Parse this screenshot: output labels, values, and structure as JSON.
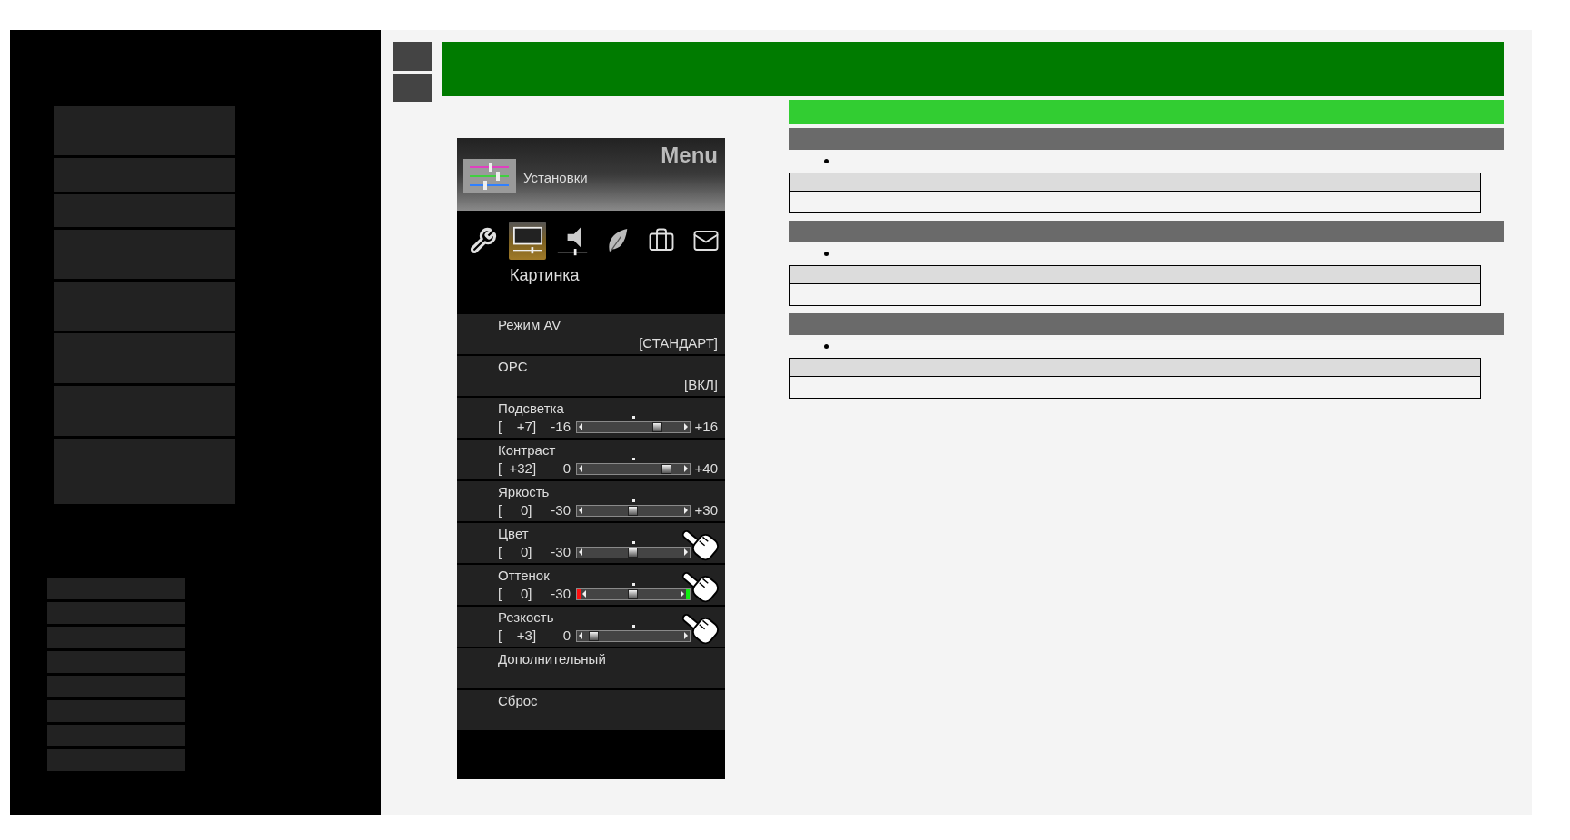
{
  "tv_menu": {
    "title": "Menu",
    "category": "Установки",
    "tabs": [
      {
        "kind": "wrench",
        "selected": false
      },
      {
        "kind": "monitor",
        "selected": true
      },
      {
        "kind": "speaker",
        "selected": false
      },
      {
        "kind": "leaf",
        "selected": false
      },
      {
        "kind": "briefcase",
        "selected": false
      },
      {
        "kind": "mail",
        "selected": false
      }
    ],
    "section": "Картинка",
    "items": [
      {
        "kind": "option",
        "label": "Режим AV",
        "value": "[СТАНДАРТ]",
        "pointer": false
      },
      {
        "kind": "option",
        "label": "OPC",
        "value": "[ВКЛ]",
        "pointer": false
      },
      {
        "kind": "slider",
        "label": "Подсветка",
        "reading": "[    +7]",
        "min": "-16",
        "max": "+16",
        "level": 0.72,
        "pointer": false
      },
      {
        "kind": "slider",
        "label": "Контраст",
        "reading": "[  +32]",
        "min": "0",
        "max": "+40",
        "level": 0.8,
        "pointer": false
      },
      {
        "kind": "slider",
        "label": "Яркость",
        "reading": "[     0]",
        "min": "-30",
        "max": "+30",
        "level": 0.5,
        "pointer": false
      },
      {
        "kind": "slider",
        "label": "Цвет",
        "reading": "[     0]",
        "min": "-30",
        "level": 0.5,
        "pointer": true
      },
      {
        "kind": "hue_slider",
        "label": "Оттенок",
        "reading": "[     0]",
        "min": "-30",
        "level": 0.5,
        "pointer": true
      },
      {
        "kind": "slider",
        "label": "Резкость",
        "reading": "[    +3]",
        "min": "0",
        "level": 0.15,
        "pointer": true
      },
      {
        "kind": "link",
        "label": "Дополнительный",
        "pointer": false
      },
      {
        "kind": "link",
        "label": "Сброс",
        "pointer": false
      }
    ]
  }
}
